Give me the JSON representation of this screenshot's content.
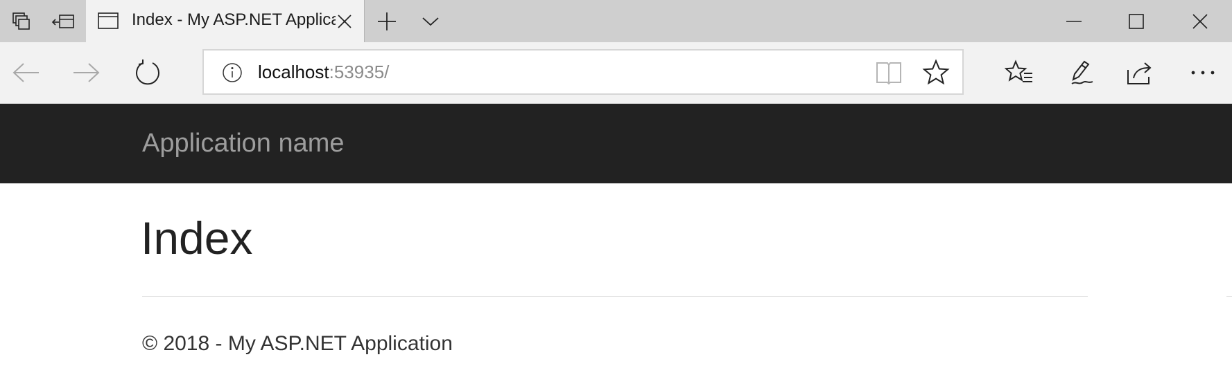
{
  "browser": {
    "tab": {
      "title": "Index - My ASP.NET Application"
    },
    "address": {
      "host": "localhost",
      "port_path": ":53935/"
    },
    "icons": {
      "tab_actions": "tab-actions-icon",
      "set_aside": "set-aside-tabs-icon",
      "page": "page-icon",
      "close_tab": "close-icon",
      "new_tab": "plus-icon",
      "tab_preview": "chevron-down-icon",
      "minimize": "minimize-icon",
      "maximize": "maximize-icon",
      "close_window": "close-window-icon",
      "back": "back-arrow-icon",
      "forward": "forward-arrow-icon",
      "refresh": "refresh-icon",
      "site_info": "info-icon",
      "reading_view": "reading-view-icon",
      "favorite": "star-icon",
      "favorites_hub": "favorites-list-icon",
      "web_note": "pen-icon",
      "share": "share-icon",
      "more": "more-icon"
    }
  },
  "page": {
    "brand": "Application name",
    "title": "Index",
    "footer": "© 2018 - My ASP.NET Application"
  },
  "colors": {
    "titlebar": "#cfcfcf",
    "tab_active": "#f2f2f2",
    "navbar": "#f2f2f2",
    "site_header": "#222222",
    "brand_text": "#9d9d9d",
    "heading_text": "#222222"
  }
}
